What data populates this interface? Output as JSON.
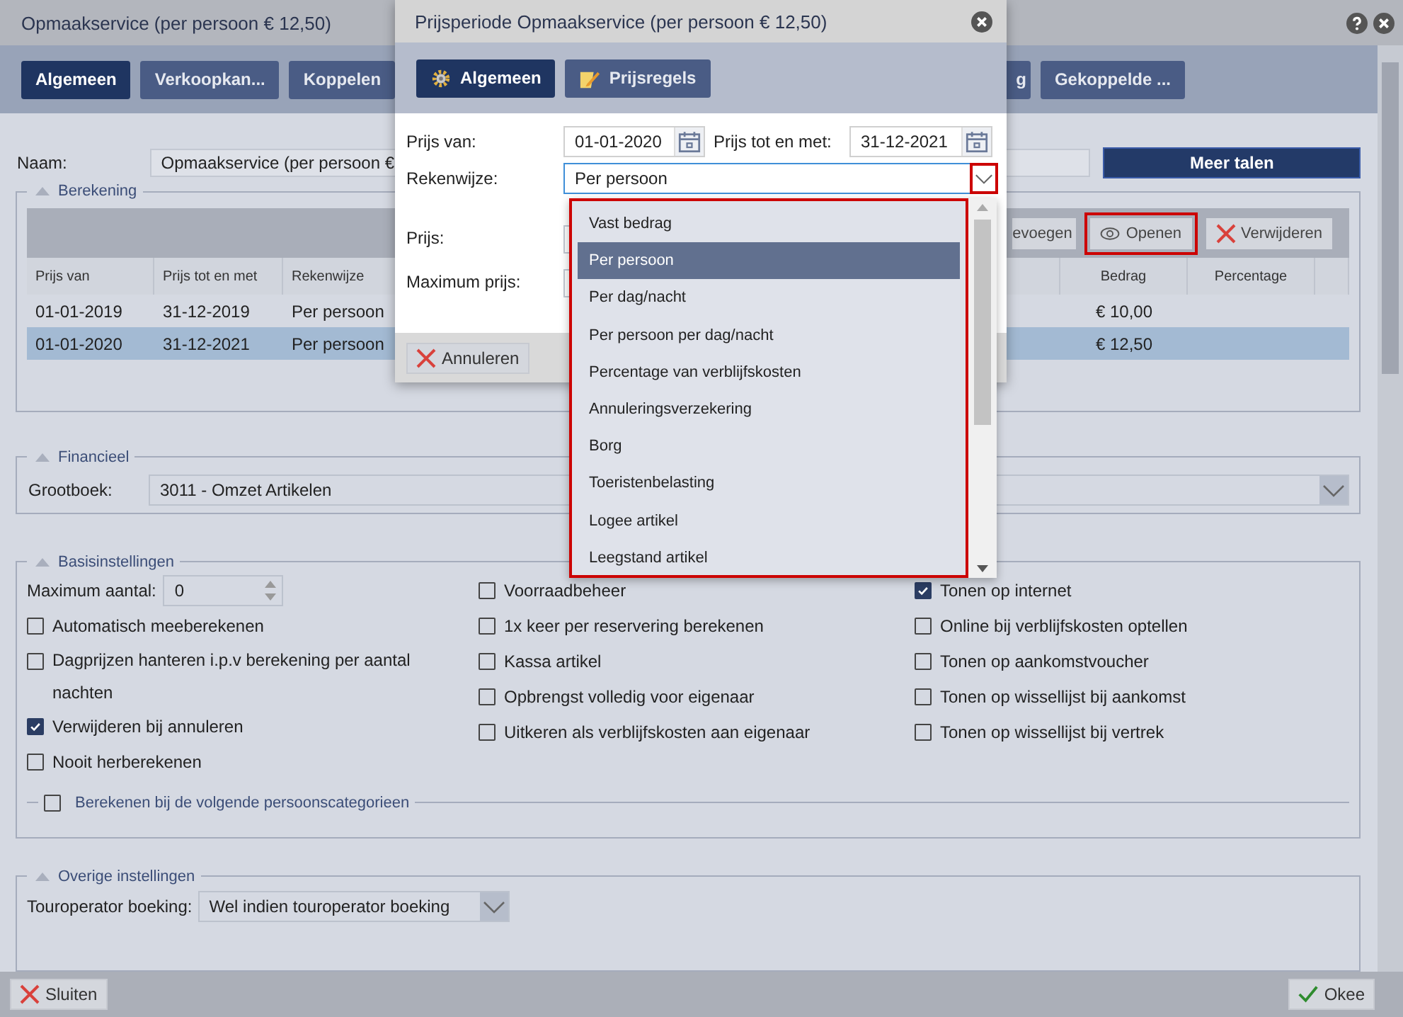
{
  "window": {
    "title": "Opmaakservice (per persoon € 12,50)"
  },
  "tabs": [
    {
      "label": "Algemeen",
      "selected": true
    },
    {
      "label": "Verkoopkan...",
      "selected": false
    },
    {
      "label": "Koppelen",
      "selected": false
    },
    {
      "label": "g",
      "selected": false
    },
    {
      "label": "Gekoppelde ...",
      "selected": false
    }
  ],
  "naam": {
    "label": "Naam:",
    "value": "Opmaakservice (per persoon €"
  },
  "meer_talen": "Meer talen",
  "berekening": {
    "legend": "Berekening",
    "toolbar": [
      {
        "label": "evoegen",
        "kind": "plain",
        "highlighted": false
      },
      {
        "label": "Openen",
        "kind": "eye",
        "highlighted": true
      },
      {
        "label": "Verwijderen",
        "kind": "delete",
        "highlighted": false
      }
    ],
    "columns": {
      "prijs_van": "Prijs van",
      "prijs_tot": "Prijs tot en met",
      "rekenwijze": "Rekenwijze",
      "bedrag": "Bedrag",
      "percentage": "Percentage"
    },
    "rows": [
      {
        "prijs_van": "01-01-2019",
        "prijs_tot": "31-12-2019",
        "rekenwijze": "Per persoon",
        "bedrag": "€ 10,00",
        "selected": false
      },
      {
        "prijs_van": "01-01-2020",
        "prijs_tot": "31-12-2021",
        "rekenwijze": "Per persoon",
        "bedrag": "€ 12,50",
        "selected": true
      }
    ]
  },
  "financieel": {
    "legend": "Financieel",
    "label": "Grootboek:",
    "value": "3011 - Omzet Artikelen"
  },
  "basis": {
    "legend": "Basisinstellingen",
    "max_label": "Maximum aantal:",
    "max_value": "0",
    "columns": [
      [
        {
          "label": "Automatisch meeberekenen",
          "checked": false
        },
        {
          "label": "Dagprijzen hanteren i.p.v berekening per aantal nachten",
          "checked": false
        },
        {
          "label": "Verwijderen bij annuleren",
          "checked": true
        },
        {
          "label": "Nooit herberekenen",
          "checked": false
        }
      ],
      [
        {
          "label": "Voorraadbeheer",
          "checked": false
        },
        {
          "label": "1x keer per reservering berekenen",
          "checked": false
        },
        {
          "label": "Kassa artikel",
          "checked": false
        },
        {
          "label": "Opbrengst volledig voor eigenaar",
          "checked": false
        },
        {
          "label": "Uitkeren als verblijfskosten aan eigenaar",
          "checked": false
        }
      ],
      [
        {
          "label": "Tonen op internet",
          "checked": true
        },
        {
          "label": "Online bij verblijfskosten optellen",
          "checked": false
        },
        {
          "label": "Tonen op aankomstvoucher",
          "checked": false
        },
        {
          "label": "Tonen op wissellijst bij aankomst",
          "checked": false
        },
        {
          "label": "Tonen op wissellijst bij vertrek",
          "checked": false
        }
      ]
    ],
    "sub": {
      "label": "Berekenen bij de volgende persoonscategorieen",
      "checked": false
    }
  },
  "overige": {
    "legend": "Overige instellingen",
    "label": "Touroperator boeking:",
    "value": "Wel indien touroperator boeking"
  },
  "footer": {
    "close": "Sluiten",
    "ok": "Okee"
  },
  "dialog": {
    "title": "Prijsperiode Opmaakservice (per persoon € 12,50)",
    "tabs": [
      {
        "label": "Algemeen",
        "selected": true,
        "kind": "gear"
      },
      {
        "label": "Prijsregels",
        "selected": false,
        "kind": "note"
      }
    ],
    "prijs_van": {
      "label": "Prijs van:",
      "value": "01-01-2020"
    },
    "prijs_tot": {
      "label": "Prijs tot en met:",
      "value": "31-12-2021"
    },
    "rekenwijze": {
      "label": "Rekenwijze:",
      "value": "Per persoon",
      "highlighted": true
    },
    "prijs": {
      "label": "Prijs:"
    },
    "maximum_prijs": {
      "label": "Maximum prijs:"
    },
    "cancel": "Annuleren"
  },
  "dropdown": {
    "highlighted": true,
    "options": [
      {
        "label": "Vast bedrag",
        "selected": false
      },
      {
        "label": "Per persoon",
        "selected": true
      },
      {
        "label": "Per dag/nacht",
        "selected": false
      },
      {
        "label": "Per persoon per dag/nacht",
        "selected": false
      },
      {
        "label": "Percentage van verblijfskosten",
        "selected": false
      },
      {
        "label": "Annuleringsverzekering",
        "selected": false
      },
      {
        "label": "Borg",
        "selected": false
      },
      {
        "label": "Toeristenbelasting",
        "selected": false
      },
      {
        "label": "Logee artikel",
        "selected": false
      },
      {
        "label": "Leegstand artikel",
        "selected": false
      }
    ]
  }
}
